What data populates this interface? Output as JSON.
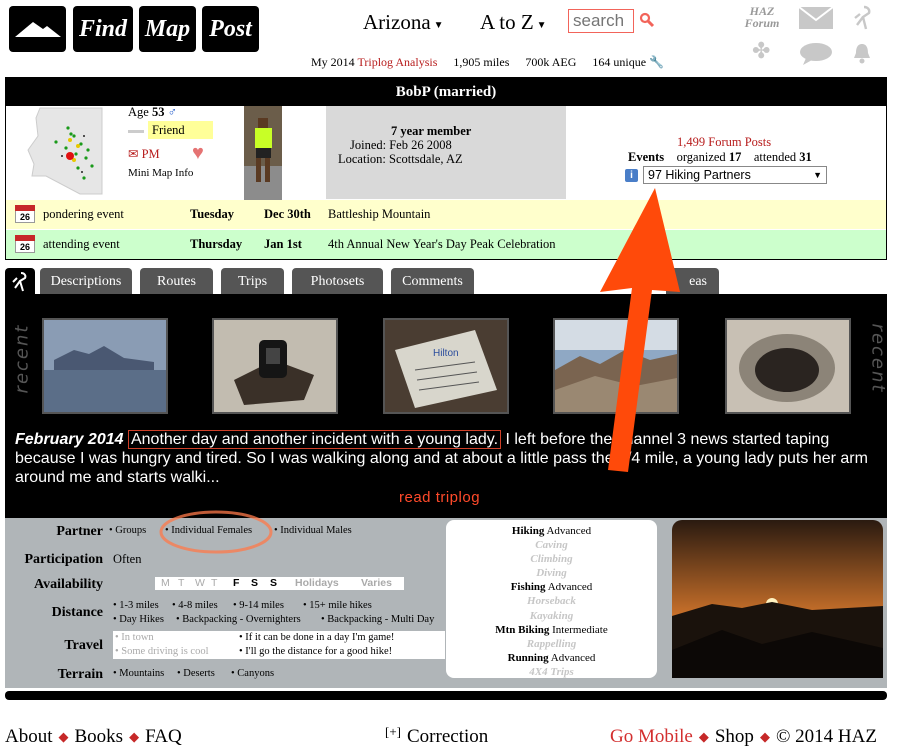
{
  "header": {
    "find": "Find",
    "map": "Map",
    "post": "Post",
    "arizona": "Arizona",
    "a_to_z": "A to Z",
    "search_placeholder": "search",
    "haz_forum_1": "HAZ",
    "haz_forum_2": "Forum"
  },
  "stats": {
    "analysis_prefix": "My 2014",
    "analysis_link": "Triplog Analysis",
    "miles": "1,905 miles",
    "aeg": "700k AEG",
    "unique": "164 unique"
  },
  "profile": {
    "title": "BobP (married)",
    "age_label": "Age",
    "age_value": "53",
    "gender_symbol": "♂",
    "friend": "Friend",
    "pm": "PM",
    "mini_map_info": "Mini Map Info",
    "member_years": "7 year member",
    "joined": "Joined: Feb 26 2008",
    "location": "Location: Scottsdale, AZ",
    "forum_posts": "1,499 Forum Posts",
    "events_label": "Events",
    "organized_label": "organized",
    "organized_value": "17",
    "attended_label": "attended",
    "attended_value": "31",
    "partners_selected": "97 Hiking Partners"
  },
  "events": [
    {
      "icon_day": "26",
      "type": "pondering event",
      "day": "Tuesday",
      "date": "Dec 30th",
      "name": "Battleship Mountain"
    },
    {
      "icon_day": "26",
      "type": "attending event",
      "day": "Thursday",
      "date": "Jan 1st",
      "name": "4th Annual New Year's Day Peak Celebration"
    }
  ],
  "tabs": [
    "Descriptions",
    "Routes",
    "Trips",
    "Photosets",
    "Comments",
    "eas"
  ],
  "recent": {
    "side_label": "recent",
    "summary_date": "February 2014",
    "summary_highlight": "Another day and another incident with a young lady.",
    "summary_rest": " I left before the channel 3 news started taping because I was hungry and tired. So I was walking along and at about a little pass the 1/4 mile, a young lady puts her arm around me and starts walki...",
    "read_more": "read triplog"
  },
  "prefs": {
    "partner_label": "Partner",
    "partner_opts": [
      "• Groups",
      "• Individual Females",
      "• Individual Males"
    ],
    "participation_label": "Participation",
    "participation_value": "Often",
    "availability_label": "Availability",
    "days": [
      "M",
      "T",
      "W",
      "T",
      "F",
      "S",
      "S"
    ],
    "holidays": "Holidays",
    "varies": "Varies",
    "distance_label": "Distance",
    "distance_opts": [
      "• 1-3 miles",
      "• 4-8 miles",
      "• 9-14 miles",
      "• 15+ mile hikes",
      "• Day Hikes",
      "• Backpacking - Overnighters",
      "• Backpacking - Multi Day"
    ],
    "travel_label": "Travel",
    "travel_opts": [
      "• In town",
      "• Some driving is cool",
      "• If it can be done in a day I'm game!",
      "• I'll go the distance for a good hike!"
    ],
    "terrain_label": "Terrain",
    "terrain_opts": [
      "• Mountains",
      "• Deserts",
      "• Canyons"
    ]
  },
  "activities": [
    {
      "name": "Hiking",
      "level": "Advanced",
      "active": true
    },
    {
      "name": "Caving",
      "level": "",
      "active": false
    },
    {
      "name": "Climbing",
      "level": "",
      "active": false
    },
    {
      "name": "Diving",
      "level": "",
      "active": false
    },
    {
      "name": "Fishing",
      "level": "Advanced",
      "active": true
    },
    {
      "name": "Horseback",
      "level": "",
      "active": false
    },
    {
      "name": "Kayaking",
      "level": "",
      "active": false
    },
    {
      "name": "Mtn Biking",
      "level": "Intermediate",
      "active": true
    },
    {
      "name": "Rappelling",
      "level": "",
      "active": false
    },
    {
      "name": "Running",
      "level": "Advanced",
      "active": true
    },
    {
      "name": "4X4 Trips",
      "level": "",
      "active": false
    }
  ],
  "footer": {
    "about": "About",
    "books": "Books",
    "faq": "FAQ",
    "correction_icon": "[+]",
    "correction": "Correction",
    "go_mobile": "Go Mobile",
    "shop": "Shop",
    "copyright": "© 2014 HAZ"
  },
  "colors": {
    "accent_red": "#b71c1c",
    "annotation_orange": "#ff4a0a",
    "pondering_bg": "#ffffcc",
    "attending_bg": "#ccffcc"
  }
}
